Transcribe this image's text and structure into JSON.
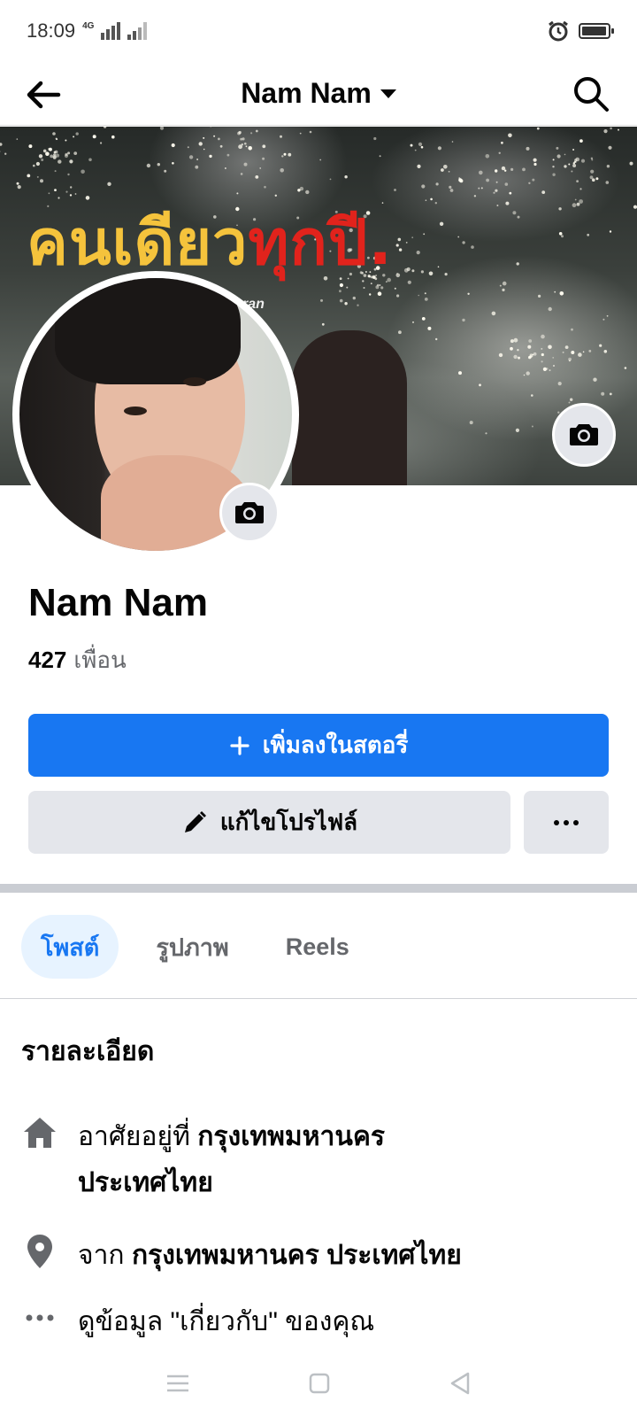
{
  "status_bar": {
    "time": "18:09",
    "network_label": "4G",
    "battery_level": 0.95
  },
  "header": {
    "title": "Nam Nam"
  },
  "cover": {
    "caption_yellow": "คนเดียว",
    "caption_red": "ทุกปี.",
    "signature": "ran"
  },
  "profile": {
    "name": "Nam Nam",
    "friends_count": "427",
    "friends_label": "เพื่อน"
  },
  "actions": {
    "add_story_label": "เพิ่มลงในสตอรี่",
    "edit_profile_label": "แก้ไขโปรไฟล์",
    "more_label": "..."
  },
  "tabs": [
    {
      "label": "โพสต์"
    },
    {
      "label": "รูปภาพ"
    },
    {
      "label": "Reels"
    }
  ],
  "details": {
    "heading": "รายละเอียด",
    "lives_in_prefix": "อาศัยอยู่ที่",
    "lives_in_value_line1": "กรุงเทพมหานคร",
    "lives_in_value_line2": "ประเทศไทย",
    "from_prefix": "จาก",
    "from_value": "กรุงเทพมหานคร ประเทศไทย",
    "about_info": "ดูข้อมูล \"เกี่ยวกับ\" ของคุณ"
  },
  "icons": {
    "back": "arrow-left-icon",
    "search": "search-icon",
    "camera": "camera-icon",
    "edit": "pencil-icon",
    "home": "home-icon",
    "location": "location-pin-icon",
    "more": "more-dots-icon"
  }
}
